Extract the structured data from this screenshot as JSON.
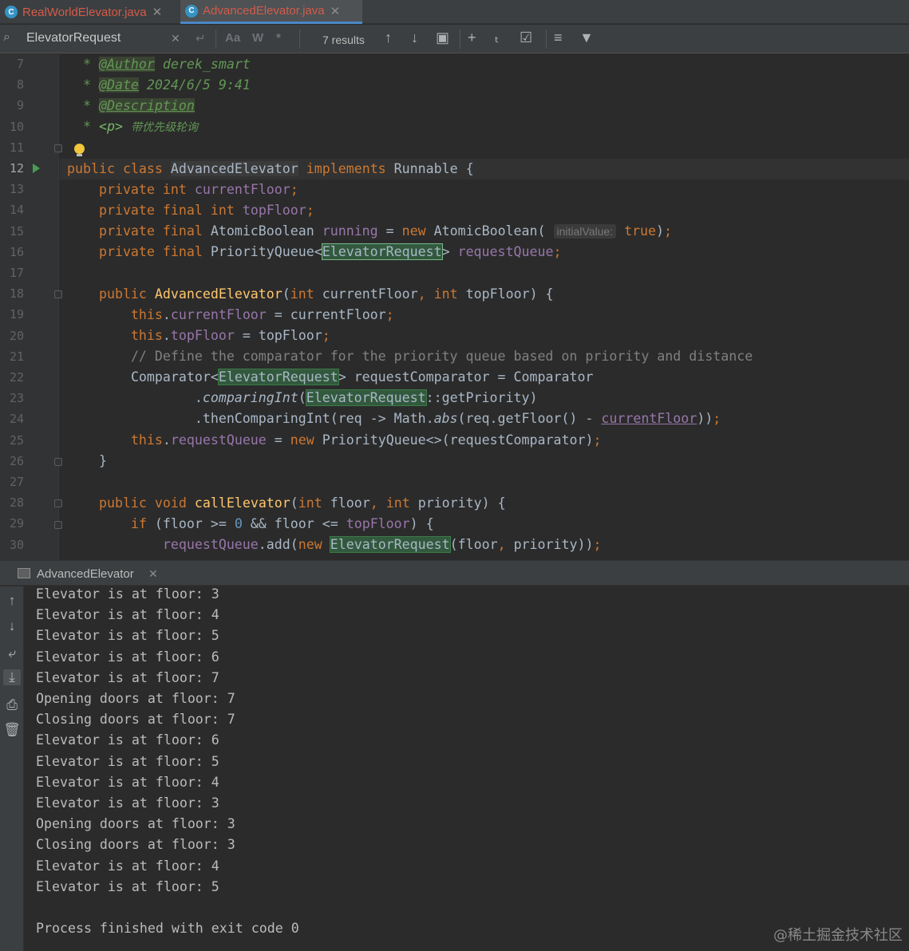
{
  "tabs": [
    {
      "label": "RealWorldElevator.java",
      "active": false
    },
    {
      "label": "AdvancedElevator.java",
      "active": true
    }
  ],
  "search": {
    "query": "ElevatorRequest",
    "results": "7 results",
    "match_case": "Aa",
    "words": "W",
    "regex": "*"
  },
  "editor": {
    "line_numbers": [
      "7",
      "8",
      "9",
      "10",
      "11",
      "12",
      "13",
      "14",
      "15",
      "16",
      "17",
      "18",
      "19",
      "20",
      "21",
      "22",
      "23",
      "24",
      "25",
      "26",
      "27",
      "28",
      "29",
      "30"
    ],
    "current_line": "12",
    "javadoc": {
      "author_tag": "@Author",
      "author": "derek_smart",
      "date_tag": "@Date",
      "date": "2024/6/5 9:41",
      "description_tag": "@Description",
      "p_tag": "<p>",
      "description": "带优先级轮询"
    },
    "code": {
      "public": "public",
      "class": "class",
      "implements": "implements",
      "private": "private",
      "final": "final",
      "int": "int",
      "new": "new",
      "this": "this",
      "void": "void",
      "if": "if",
      "class_name": "AdvancedElevator",
      "runnable": "Runnable",
      "current_floor": "currentFloor",
      "top_floor": "topFloor",
      "atomic_boolean": "AtomicBoolean",
      "running": "running",
      "initial_value_hint": "initialValue:",
      "true": "true",
      "priority_queue": "PriorityQueue",
      "elevator_request": "ElevatorRequest",
      "request_queue": "requestQueue",
      "comment": "// Define the comparator for the priority queue based on priority and distance",
      "comparator": "Comparator",
      "request_comparator": "requestComparator",
      "comparing_int": "comparingInt",
      "get_priority": "getPriority",
      "then_comparing": "thenComparingInt(req -> Math.",
      "abs": "abs",
      "get_floor": "(req.getFloor() - ",
      "call_elevator": "callElevator",
      "floor": "floor",
      "priority": "priority",
      "zero": "0",
      "add": "add"
    }
  },
  "run_panel": {
    "title": "AdvancedElevator",
    "output": [
      "Elevator is at floor: 3",
      "Elevator is at floor: 4",
      "Elevator is at floor: 5",
      "Elevator is at floor: 6",
      "Elevator is at floor: 7",
      "Opening doors at floor: 7",
      "Closing doors at floor: 7",
      "Elevator is at floor: 6",
      "Elevator is at floor: 5",
      "Elevator is at floor: 4",
      "Elevator is at floor: 3",
      "Opening doors at floor: 3",
      "Closing doors at floor: 3",
      "Elevator is at floor: 4",
      "Elevator is at floor: 5",
      "",
      "Process finished with exit code 0"
    ]
  },
  "watermark": "@稀土掘金技术社区"
}
